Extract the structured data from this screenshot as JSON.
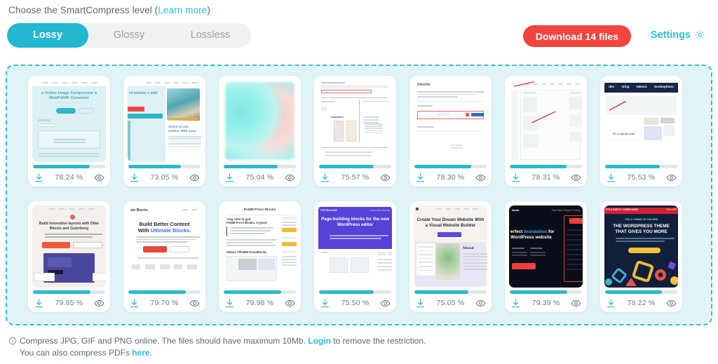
{
  "header": {
    "prompt_text": "Choose the SmartCompress level (",
    "learn_more": "Learn more",
    "prompt_close": ")"
  },
  "tabs": [
    {
      "label": "Lossy",
      "active": true
    },
    {
      "label": "Glossy",
      "active": false
    },
    {
      "label": "Lossless",
      "active": false
    }
  ],
  "actions": {
    "download_label": "Download 14 files",
    "download_color": "#f1453d",
    "settings_label": "Settings",
    "accent_color": "#2cc0d4"
  },
  "dropzone": {
    "border_color": "#37bfd0",
    "background_color": "#e0f4f7"
  },
  "files": [
    {
      "percent": "78.24 %",
      "fill": 78.24,
      "kind": "compressor-hero",
      "title": "e Online Image Compressor a WebP/AVIF Converter"
    },
    {
      "percent": "73.05 %",
      "fill": 73.05,
      "kind": "photo-hero",
      "title": "rd satisfac s with"
    },
    {
      "percent": "75.04 %",
      "fill": 75.04,
      "kind": "blurred-teal",
      "title": ""
    },
    {
      "percent": "75.57 %",
      "fill": 75.57,
      "kind": "doc-form",
      "title": ""
    },
    {
      "percent": "78.30 %",
      "fill": 78.3,
      "kind": "settings-panel",
      "title": "neurio"
    },
    {
      "percent": "78.31 %",
      "fill": 78.31,
      "kind": "annotated-editor",
      "title": ""
    },
    {
      "percent": "75.53 %",
      "fill": 75.53,
      "kind": "dark-nav",
      "title": "dev  sting  telecro  bookoptions"
    },
    {
      "percent": "79.85 %",
      "fill": 79.85,
      "kind": "otter-blocks",
      "title": "Build innovative layouts with Otter Blocks and Gutenberg"
    },
    {
      "percent": "79.70 %",
      "fill": 79.7,
      "kind": "ultimate-blocks",
      "title": "Build Better Content With Ultimate Blocks."
    },
    {
      "percent": "79.98 %",
      "fill": 79.98,
      "kind": "polite-press",
      "title": "PoMM Press Blocks"
    },
    {
      "percent": "75.50 %",
      "fill": 75.5,
      "kind": "purple-hero",
      "title": "Page-building blocks for the new WordPress editor"
    },
    {
      "percent": "75.05 %",
      "fill": 75.05,
      "kind": "dream-website",
      "title": "Create Your Dream Website With a Visual Website Builder"
    },
    {
      "percent": "79.39 %",
      "fill": 79.39,
      "kind": "dark-foundation",
      "title": "erfect foundation for WordPress website"
    },
    {
      "percent": "78.22 %",
      "fill": 78.22,
      "kind": "wp-theme",
      "title": "THE WORDPRESS THEME THAT GIVES YOU MORE"
    }
  ],
  "card_icons": {
    "download": "download-icon",
    "preview": "eye-icon"
  },
  "footer": {
    "line1_a": "Compress JPG, GIF and PNG online. The files should have maximum 10Mb. ",
    "login_label": "Login",
    "line1_b": " to remove the restriction.",
    "line2_a": "You can also compress PDFs ",
    "here_label": "here",
    "line2_b": "."
  }
}
